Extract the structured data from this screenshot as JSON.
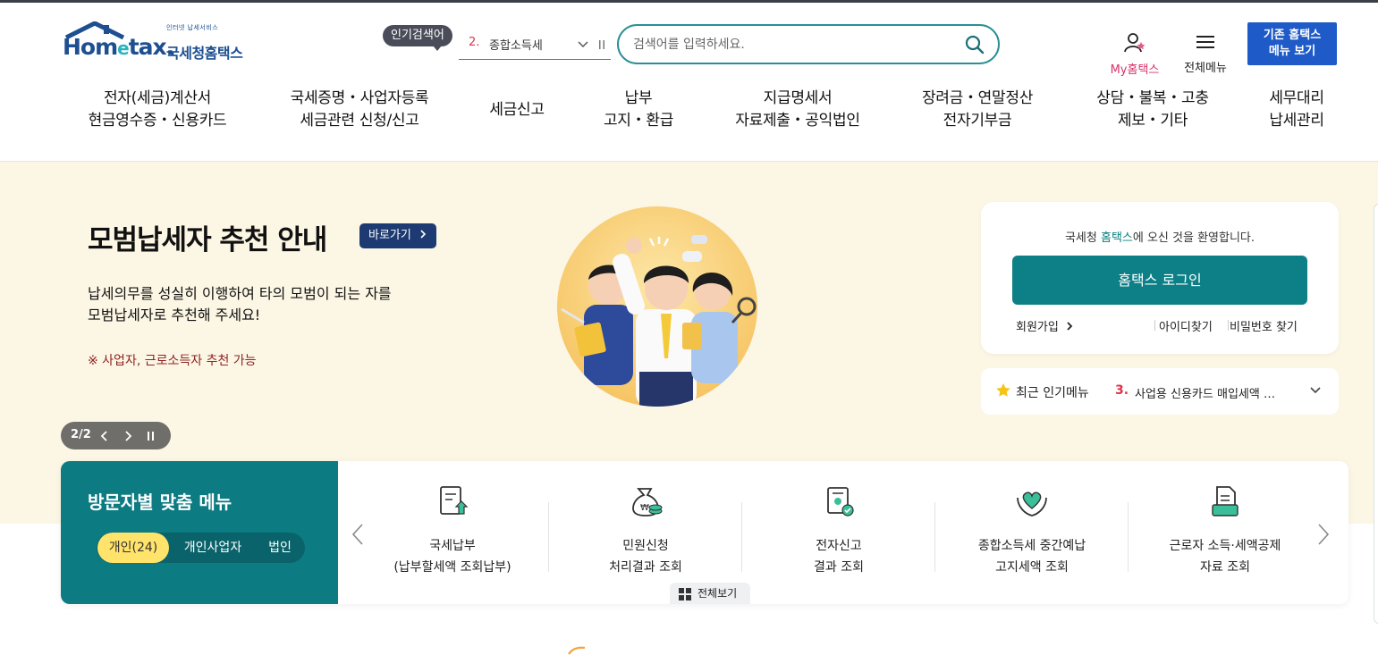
{
  "header": {
    "logo_small": "인터넷 납세서비스",
    "logo_word_1": "Hom",
    "logo_word_e": "e",
    "logo_word_2": "tax.",
    "logo_ko": "국세청홈택스",
    "popular_label": "인기검색어",
    "popular_rank": "2.",
    "popular_term": "종합소득세",
    "search_placeholder": "검색어를 입력하세요.",
    "my_home_label": "My홈택스",
    "all_menu_label": "전체메뉴",
    "old_home_line1": "기존 홈택스",
    "old_home_line2": "메뉴 보기"
  },
  "gnb": [
    {
      "line1": "전자(세금)계산서",
      "line2": "현금영수증・신용카드"
    },
    {
      "line1": "국세증명・사업자등록",
      "line2": "세금관련 신청/신고"
    },
    {
      "line1": "세금신고",
      "line2": ""
    },
    {
      "line1": "납부",
      "line2": "고지・환급"
    },
    {
      "line1": "지급명세서",
      "line2": "자료제출・공익법인"
    },
    {
      "line1": "장려금・연말정산",
      "line2": "전자기부금"
    },
    {
      "line1": "상담・불복・고충",
      "line2": "제보・기타"
    },
    {
      "line1": "세무대리",
      "line2": "납세관리"
    }
  ],
  "hero": {
    "title": "모범납세자 추천 안내",
    "go_label": "바로가기",
    "desc_line1": "납세의무를 성실히 이행하여 타의 모범이 되는 자를",
    "desc_line2": "모범납세자로 추천해 주세요!",
    "note": "※ 사업자, 근로소득자 추천 가능",
    "slide_counter": "2/2"
  },
  "login": {
    "welcome_pre": "국세청 ",
    "welcome_hl": "홈택스",
    "welcome_post": "에 오신 것을 환영합니다.",
    "login_button": "홈택스 로그인",
    "join_label": "회원가입",
    "find_id_label": "아이디찾기",
    "find_pw_label": "비밀번호 찾기"
  },
  "recent": {
    "label": "최근 인기메뉴",
    "rank": "3.",
    "item": "사업용 신용카드 매입세액 …"
  },
  "visitor": {
    "title": "방문자별 맞춤 메뉴",
    "tabs": [
      "개인(24)",
      "개인사업자",
      "법인"
    ],
    "items": [
      {
        "line1": "국세납부",
        "line2": "(납부할세액 조회납부)"
      },
      {
        "line1": "민원신청",
        "line2": "처리결과 조회"
      },
      {
        "line1": "전자신고",
        "line2": "결과 조회"
      },
      {
        "line1": "종합소득세 중간예납",
        "line2": "고지세액 조회"
      },
      {
        "line1": "근로자 소득·세액공제",
        "line2": "자료 조회"
      }
    ],
    "view_all": "전체보기"
  },
  "colors": {
    "brand_navy": "#1d4f91",
    "teal": "#0d8087",
    "hero_bg": "#fcf6e4",
    "accent_yellow": "#ffe36a",
    "rank_red": "#e0334a",
    "old_home_blue": "#1e5ac8"
  }
}
